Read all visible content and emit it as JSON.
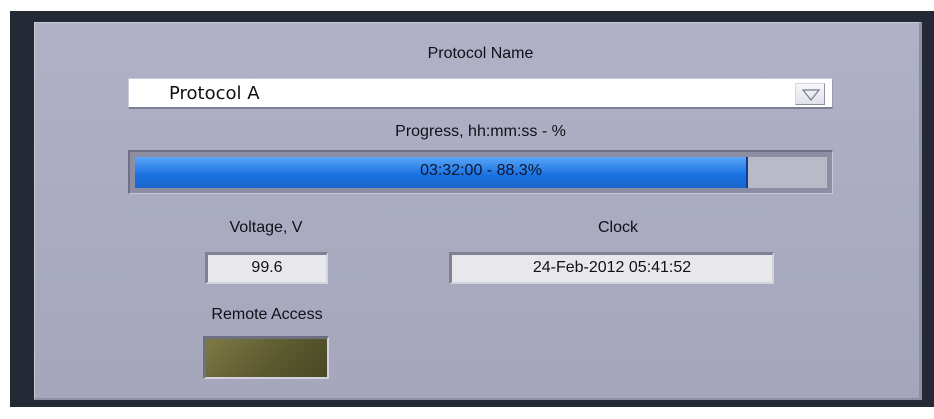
{
  "protocol": {
    "label": "Protocol Name",
    "selected": "Protocol A",
    "dropdown_icon": "triangle-down-icon"
  },
  "progress": {
    "label": "Progress, hh:mm:ss - %",
    "text": "03:32:00  -  88.3%",
    "fraction": 0.883,
    "fill_color": "#1a74e6"
  },
  "voltage": {
    "label": "Voltage, V",
    "value": "99.6"
  },
  "clock": {
    "label": "Clock",
    "value": "24-Feb-2012   05:41:52"
  },
  "remote_access": {
    "label": "Remote Access",
    "state": "off",
    "led_color": "#5c5a2f"
  }
}
